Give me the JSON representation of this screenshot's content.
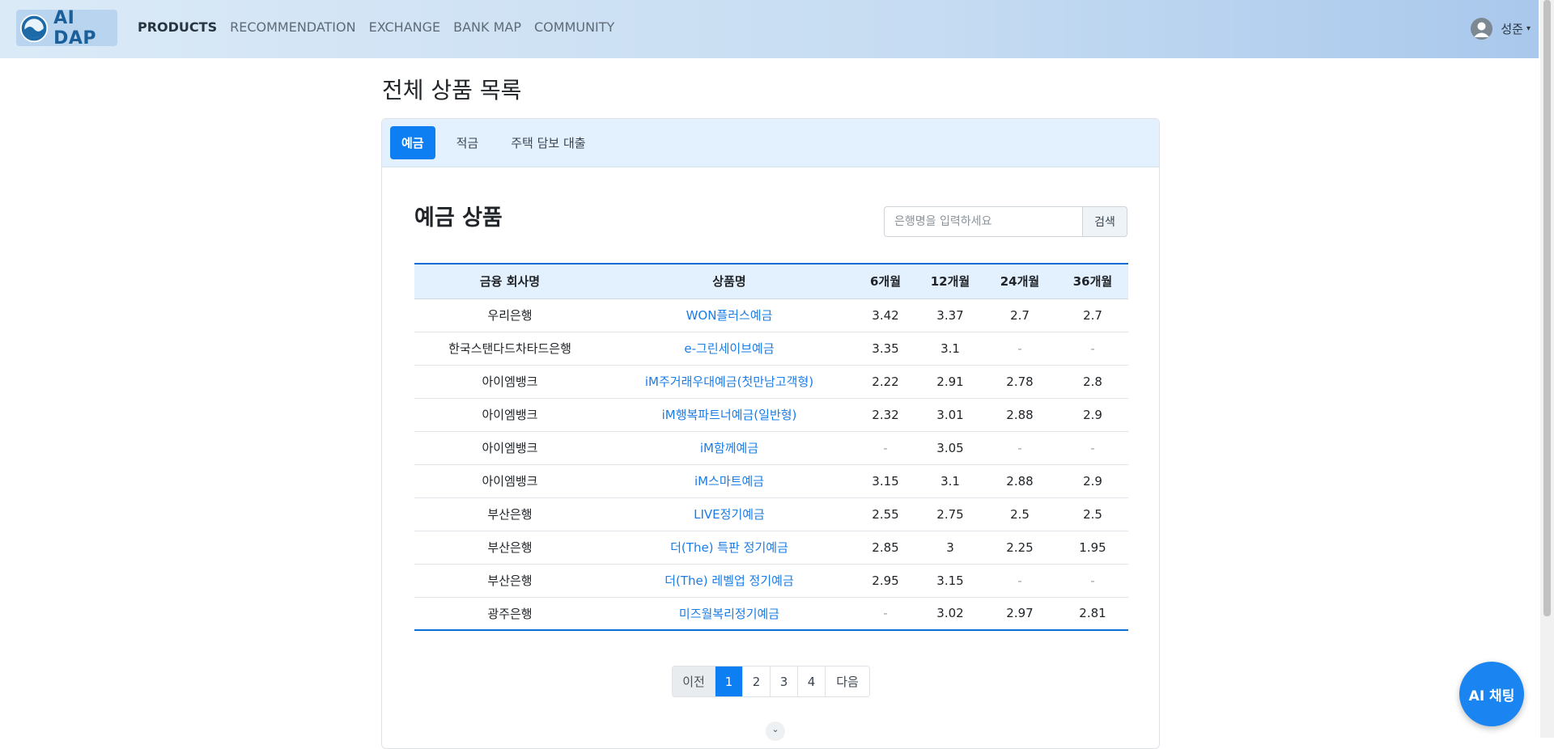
{
  "nav": {
    "logo_text": "AI DAP",
    "links": [
      "PRODUCTS",
      "RECOMMENDATION",
      "EXCHANGE",
      "BANK MAP",
      "COMMUNITY"
    ],
    "active_link": "PRODUCTS",
    "user_name": "성준",
    "user_caret": "▾"
  },
  "page": {
    "title": "전체 상품 목록"
  },
  "tabs": [
    {
      "label": "예금",
      "active": true
    },
    {
      "label": "적금",
      "active": false
    },
    {
      "label": "주택 담보 대출",
      "active": false
    }
  ],
  "section": {
    "title": "예금 상품"
  },
  "search": {
    "placeholder": "은행명을 입력하세요",
    "value": "",
    "button_label": "검색"
  },
  "table": {
    "headers": [
      "금융 회사명",
      "상품명",
      "6개월",
      "12개월",
      "24개월",
      "36개월"
    ],
    "rows": [
      [
        "우리은행",
        "WON플러스예금",
        "3.42",
        "3.37",
        "2.7",
        "2.7"
      ],
      [
        "한국스탠다드차타드은행",
        "e-그린세이브예금",
        "3.35",
        "3.1",
        "-",
        "-"
      ],
      [
        "아이엠뱅크",
        "iM주거래우대예금(첫만남고객형)",
        "2.22",
        "2.91",
        "2.78",
        "2.8"
      ],
      [
        "아이엠뱅크",
        "iM행복파트너예금(일반형)",
        "2.32",
        "3.01",
        "2.88",
        "2.9"
      ],
      [
        "아이엠뱅크",
        "iM함께예금",
        "-",
        "3.05",
        "-",
        "-"
      ],
      [
        "아이엠뱅크",
        "iM스마트예금",
        "3.15",
        "3.1",
        "2.88",
        "2.9"
      ],
      [
        "부산은행",
        "LIVE정기예금",
        "2.55",
        "2.75",
        "2.5",
        "2.5"
      ],
      [
        "부산은행",
        "더(The) 특판 정기예금",
        "2.85",
        "3",
        "2.25",
        "1.95"
      ],
      [
        "부산은행",
        "더(The) 레벨업 정기예금",
        "2.95",
        "3.15",
        "-",
        "-"
      ],
      [
        "광주은행",
        "미즈월복리정기예금",
        "-",
        "3.02",
        "2.97",
        "2.81"
      ]
    ]
  },
  "pagination": {
    "prev": "이전",
    "pages": [
      "1",
      "2",
      "3",
      "4"
    ],
    "current": "1",
    "next": "다음"
  },
  "scroll_down_icon": "⌄",
  "chat_button": "AI 채팅",
  "colors": {
    "accent": "#0d7ff2",
    "link": "#1a7ce6",
    "header_bg": "#e3f0fd"
  }
}
